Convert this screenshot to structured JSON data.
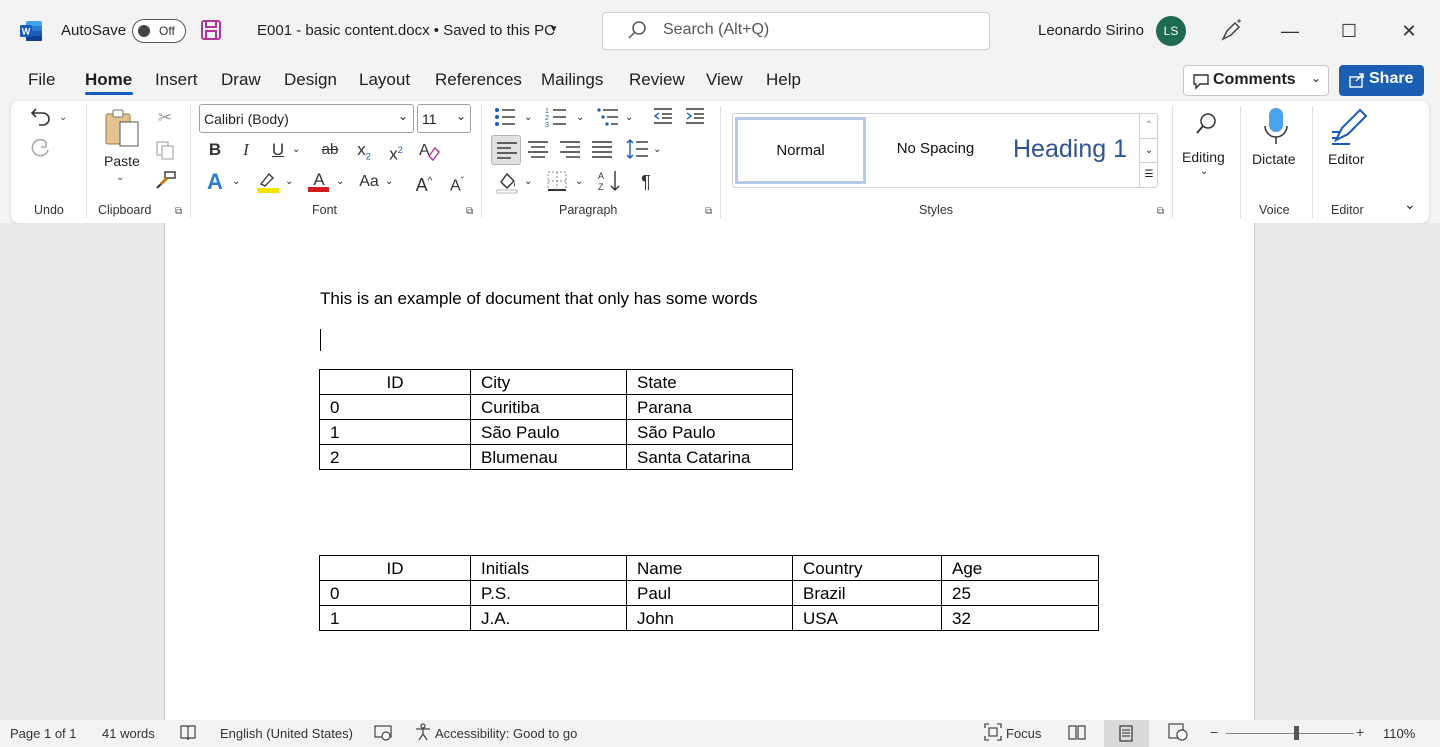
{
  "titlebar": {
    "autosave_label": "AutoSave",
    "autosave_state": "Off",
    "doc_title": "E001 - basic content.docx • Saved to this PC",
    "search_placeholder": "Search (Alt+Q)",
    "user_name": "Leonardo Sirino",
    "user_initials": "LS"
  },
  "menu": {
    "tabs": [
      "File",
      "Home",
      "Insert",
      "Draw",
      "Design",
      "Layout",
      "References",
      "Mailings",
      "Review",
      "View",
      "Help"
    ],
    "active": "Home",
    "comments_label": "Comments",
    "share_label": "Share"
  },
  "ribbon": {
    "groups": {
      "undo": "Undo",
      "clipboard": "Clipboard",
      "font": "Font",
      "paragraph": "Paragraph",
      "styles": "Styles",
      "voice": "Voice",
      "editor": "Editor"
    },
    "paste_label": "Paste",
    "font_name": "Calibri (Body)",
    "font_size": "11",
    "styles": [
      "Normal",
      "No Spacing",
      "Heading 1"
    ],
    "editing_label": "Editing",
    "dictate_label": "Dictate",
    "editor_label": "Editor",
    "font_buttons": {
      "bold": "B",
      "italic": "I",
      "underline": "U",
      "strike": "ab",
      "subscript": "x",
      "superscript": "x",
      "change_case": "Aa",
      "grow": "A",
      "shrink": "A",
      "text_effects": "A",
      "font_color": "A"
    },
    "colors": {
      "highlight": "#f5e400",
      "font_color": "#d11f1f",
      "accent": "#185abd",
      "heading": "#2f5496"
    }
  },
  "document": {
    "paragraph": "This is an example of document that only has some words",
    "table1": {
      "headers": [
        "ID",
        "City",
        "State"
      ],
      "rows": [
        [
          "0",
          "Curitiba",
          "Parana"
        ],
        [
          "1",
          "São Paulo",
          "São Paulo"
        ],
        [
          "2",
          "Blumenau",
          "Santa Catarina"
        ]
      ]
    },
    "table2": {
      "headers": [
        "ID",
        "Initials",
        "Name",
        "Country",
        "Age"
      ],
      "rows": [
        [
          "0",
          "P.S.",
          "Paul",
          "Brazil",
          "25"
        ],
        [
          "1",
          "J.A.",
          "John",
          "USA",
          "32"
        ]
      ]
    }
  },
  "statusbar": {
    "page": "Page 1 of 1",
    "words": "41 words",
    "language": "English (United States)",
    "accessibility": "Accessibility: Good to go",
    "focus": "Focus",
    "zoom": "110%",
    "zoom_fraction": 0.55
  }
}
